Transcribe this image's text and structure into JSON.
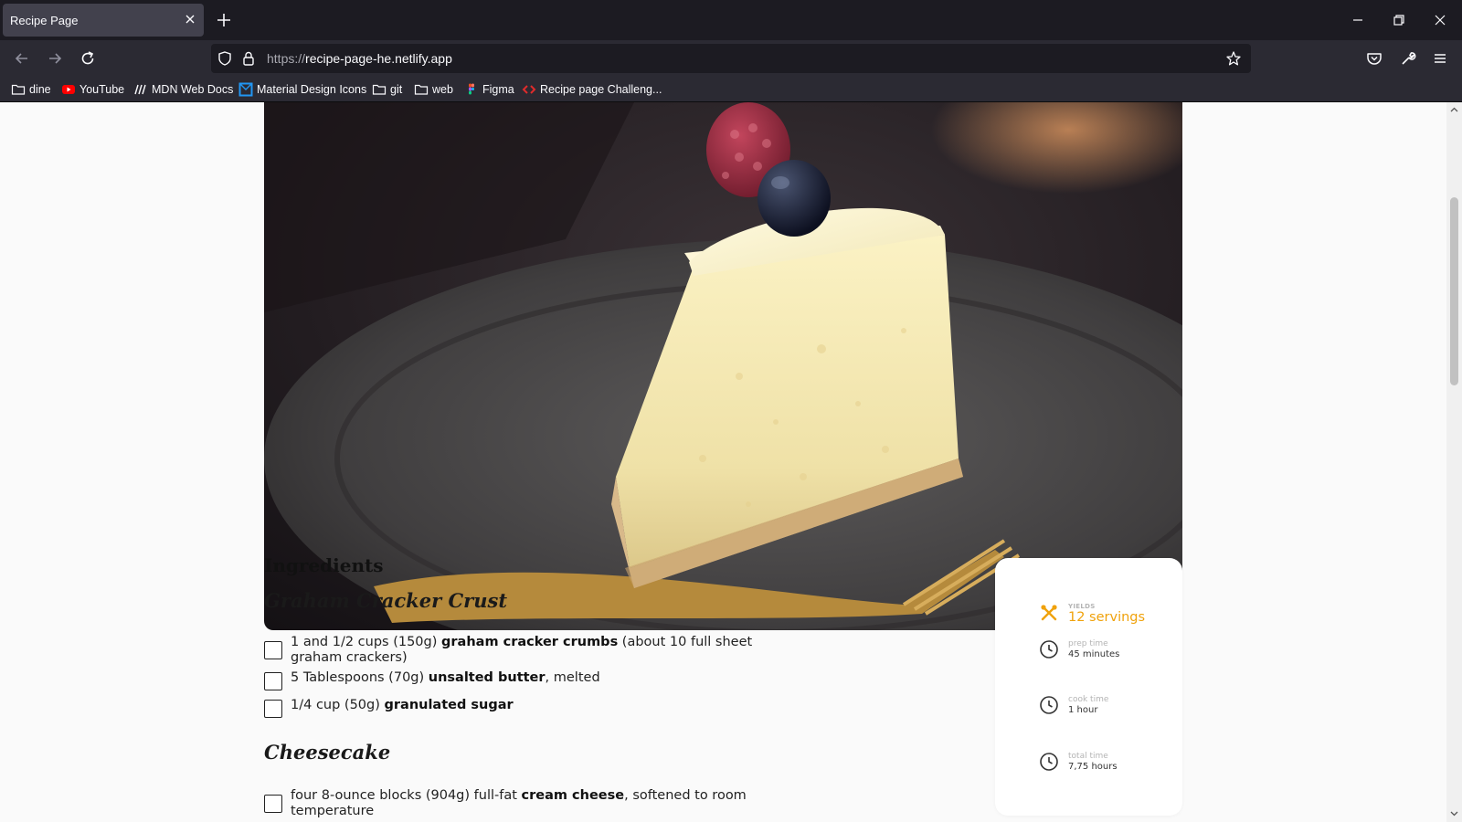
{
  "browser": {
    "tab": {
      "title": "Recipe Page"
    },
    "url": {
      "scheme": "https://",
      "host": "recipe-page-he.netlify.app"
    },
    "bookmarks": [
      {
        "label": "dine",
        "icon": "folder-icon"
      },
      {
        "label": "YouTube",
        "icon": "youtube-icon"
      },
      {
        "label": "MDN Web Docs",
        "icon": "mdn-icon"
      },
      {
        "label": "Material Design Icons",
        "icon": "material-design-icon"
      },
      {
        "label": "git",
        "icon": "folder-icon"
      },
      {
        "label": "web",
        "icon": "folder-icon"
      },
      {
        "label": "Figma",
        "icon": "figma-icon"
      },
      {
        "label": "Recipe page Challeng...",
        "icon": "frontend-mentor-icon"
      }
    ]
  },
  "recipe": {
    "ingredients_title": "Ingredients",
    "sections": [
      {
        "title": "Graham Cracker Crust",
        "items": [
          {
            "pre": "1 and 1/2 cups (150g) ",
            "bold": "graham cracker crumbs",
            "post": " (about 10 full sheet graham crackers)"
          },
          {
            "pre": "5 Tablespoons (70g) ",
            "bold": "unsalted butter",
            "post": ", melted"
          },
          {
            "pre": "1/4 cup (50g) ",
            "bold": "granulated sugar",
            "post": ""
          }
        ]
      },
      {
        "title": "Cheesecake",
        "items": [
          {
            "pre": "four 8-ounce blocks (904g) full-fat ",
            "bold": "cream cheese",
            "post": ", softened to room temperature"
          }
        ]
      }
    ],
    "info": {
      "yields": {
        "label": "YIELDS",
        "value": "12 servings"
      },
      "prep": {
        "label": "prep time",
        "value": "45 minutes"
      },
      "cook": {
        "label": "cook time",
        "value": "1 hour"
      },
      "total": {
        "label": "total time",
        "value": "7,75 hours"
      }
    },
    "colors": {
      "accent": "#f0a20b",
      "text": "#222222",
      "background": "#fafafa"
    }
  }
}
